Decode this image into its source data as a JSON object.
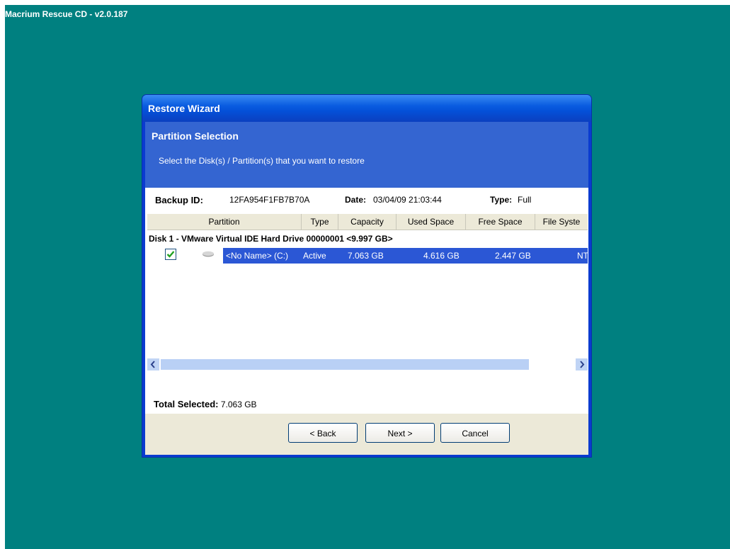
{
  "desktop": {
    "title": "Macrium Rescue CD - v2.0.187"
  },
  "window": {
    "title": "Restore Wizard"
  },
  "header": {
    "title": "Partition Selection",
    "subtitle": "Select the Disk(s) / Partition(s) that you want to restore"
  },
  "backup_info": {
    "id_label": "Backup ID:",
    "id_value": "12FA954F1FB7B70A",
    "date_label": "Date:",
    "date_value": "03/04/09 21:03:44",
    "type_label": "Type:",
    "type_value": "Full"
  },
  "table": {
    "columns": [
      "Partition",
      "Type",
      "Capacity",
      "Used Space",
      "Free Space",
      "File Syste"
    ],
    "disk_label": "Disk 1 - VMware Virtual IDE Hard Drive 00000001  <9.997 GB>",
    "rows": [
      {
        "checked": true,
        "partition": "<No Name> (C:)",
        "type": "Active",
        "capacity": "7.063 GB",
        "used": "4.616 GB",
        "free": "2.447 GB",
        "fs": "NT"
      }
    ]
  },
  "summary": {
    "total_label": "Total Selected:",
    "total_value": "7.063 GB"
  },
  "buttons": {
    "back": "< Back",
    "next": "Next >",
    "cancel": "Cancel"
  },
  "icons": {
    "checkbox": "check-icon",
    "drive": "hard-drive-icon",
    "scroll_left": "chevron-left-icon",
    "scroll_right": "chevron-right-icon"
  },
  "colors": {
    "desktop": "#008080",
    "header": "#3465d1",
    "selection": "#2b57d5",
    "titlebar": "#0a5ce0"
  }
}
